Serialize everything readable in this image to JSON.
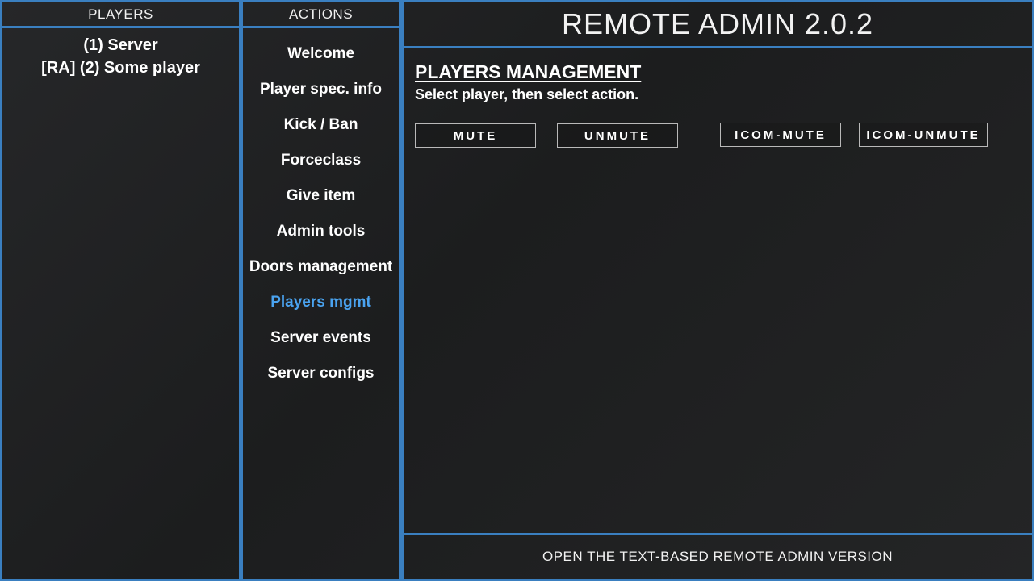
{
  "players": {
    "header": "PLAYERS",
    "items": [
      {
        "label": "(1) Server"
      },
      {
        "label": "[RA] (2) Some player"
      }
    ]
  },
  "actions": {
    "header": "ACTIONS",
    "items": [
      {
        "label": "Welcome",
        "active": false
      },
      {
        "label": "Player spec. info",
        "active": false
      },
      {
        "label": "Kick / Ban",
        "active": false
      },
      {
        "label": "Forceclass",
        "active": false
      },
      {
        "label": "Give item",
        "active": false
      },
      {
        "label": "Admin tools",
        "active": false
      },
      {
        "label": "Doors management",
        "active": false
      },
      {
        "label": "Players mgmt",
        "active": true
      },
      {
        "label": "Server events",
        "active": false
      },
      {
        "label": "Server configs",
        "active": false
      }
    ]
  },
  "title": "REMOTE ADMIN 2.0.2",
  "main": {
    "heading": "PLAYERS MANAGEMENT",
    "subtitle": "Select player, then select action.",
    "buttons": {
      "mute": "MUTE",
      "unmute": "UNMUTE",
      "icom_mute": "ICOM-MUTE",
      "icom_unmute": "ICOM-UNMUTE"
    }
  },
  "footer": {
    "label": "OPEN THE TEXT-BASED REMOTE ADMIN VERSION"
  },
  "colors": {
    "border": "#3a7fc0",
    "active_text": "#4aa3f0",
    "background": "#1e1f20"
  }
}
